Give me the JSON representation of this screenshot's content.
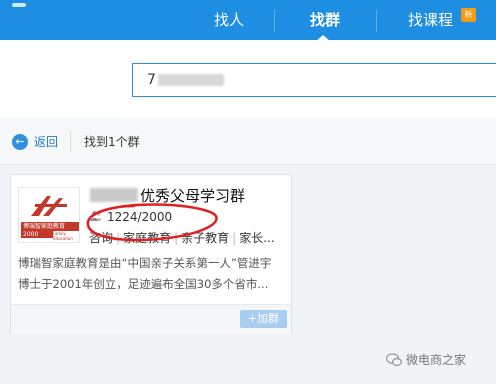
{
  "header": {
    "tabs": [
      {
        "label": "找人"
      },
      {
        "label": "找群"
      },
      {
        "label": "找课程",
        "badge": "新"
      }
    ],
    "active_tab": "找群",
    "accent": "#1e8ee2"
  },
  "search": {
    "value_visible": "7"
  },
  "nav": {
    "back_label": "返回",
    "result_label": "找到1个群"
  },
  "group_card": {
    "name_visible": "优秀父母学习群",
    "member_count": "1224/2000",
    "tags": [
      "咨询",
      "家庭教育",
      "亲子教育",
      "家长..."
    ],
    "description": "博瑞智家庭教育是由“中国亲子关系第一人”管进宇博士于2001年创立，足迹遍布全国30多个省市...",
    "join_label": "+加群",
    "avatar_text": {
      "brand": "博瑞智家庭教育",
      "year": "2000",
      "sub": "Family Education"
    }
  },
  "annotation": {
    "color": "#e02020"
  },
  "watermark": "微电商之家"
}
